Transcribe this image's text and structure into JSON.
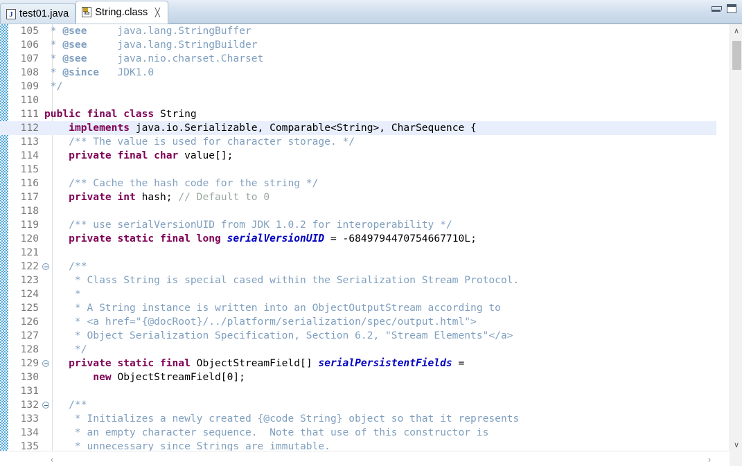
{
  "window": {
    "minimize_label": "–",
    "maximize_label": "□"
  },
  "tabs": [
    {
      "label": "test01.java",
      "icon": "java-file-icon",
      "active": false,
      "closable": false
    },
    {
      "label": "String.class",
      "icon": "class-file-icon",
      "active": true,
      "closable": true,
      "close_label": "╳"
    }
  ],
  "editor": {
    "first_line": 105,
    "current_line": 112,
    "fold_lines": [
      122,
      129,
      132
    ],
    "lines": [
      {
        "no": "105",
        "segments": [
          {
            "t": " * ",
            "c": "jdoc"
          },
          {
            "t": "@see",
            "c": "jtag"
          },
          {
            "t": "     java.lang.StringBuffer",
            "c": "jdoc"
          }
        ]
      },
      {
        "no": "106",
        "segments": [
          {
            "t": " * ",
            "c": "jdoc"
          },
          {
            "t": "@see",
            "c": "jtag"
          },
          {
            "t": "     java.lang.StringBuilder",
            "c": "jdoc"
          }
        ]
      },
      {
        "no": "107",
        "segments": [
          {
            "t": " * ",
            "c": "jdoc"
          },
          {
            "t": "@see",
            "c": "jtag"
          },
          {
            "t": "     java.nio.charset.Charset",
            "c": "jdoc"
          }
        ]
      },
      {
        "no": "108",
        "segments": [
          {
            "t": " * ",
            "c": "jdoc"
          },
          {
            "t": "@since",
            "c": "jtag"
          },
          {
            "t": "   JDK1.0",
            "c": "jdoc"
          }
        ]
      },
      {
        "no": "109",
        "segments": [
          {
            "t": " */",
            "c": "jdoc"
          }
        ]
      },
      {
        "no": "110",
        "segments": [
          {
            "t": "",
            "c": "plain"
          }
        ]
      },
      {
        "no": "111",
        "segments": [
          {
            "t": "public final class",
            "c": "kw"
          },
          {
            "t": " String",
            "c": "plain"
          }
        ]
      },
      {
        "no": "112",
        "segments": [
          {
            "t": "    ",
            "c": "plain"
          },
          {
            "t": "implements",
            "c": "kw"
          },
          {
            "t": " java.io.Serializable, Comparable<String>, CharSequence {",
            "c": "plain"
          }
        ]
      },
      {
        "no": "113",
        "segments": [
          {
            "t": "    /** The value is used for character storage. */",
            "c": "cmt"
          }
        ]
      },
      {
        "no": "114",
        "segments": [
          {
            "t": "    ",
            "c": "plain"
          },
          {
            "t": "private final char",
            "c": "kw"
          },
          {
            "t": " value[];",
            "c": "plain"
          }
        ]
      },
      {
        "no": "115",
        "segments": [
          {
            "t": "",
            "c": "plain"
          }
        ]
      },
      {
        "no": "116",
        "segments": [
          {
            "t": "    /** Cache the hash code for the string */",
            "c": "cmt"
          }
        ]
      },
      {
        "no": "117",
        "segments": [
          {
            "t": "    ",
            "c": "plain"
          },
          {
            "t": "private int",
            "c": "kw"
          },
          {
            "t": " hash; ",
            "c": "plain"
          },
          {
            "t": "// Default to 0",
            "c": "lcmt"
          }
        ]
      },
      {
        "no": "118",
        "segments": [
          {
            "t": "",
            "c": "plain"
          }
        ]
      },
      {
        "no": "119",
        "segments": [
          {
            "t": "    /** use serialVersionUID from JDK 1.0.2 for interoperability */",
            "c": "cmt"
          }
        ]
      },
      {
        "no": "120",
        "segments": [
          {
            "t": "    ",
            "c": "plain"
          },
          {
            "t": "private static final long",
            "c": "kw"
          },
          {
            "t": " ",
            "c": "plain"
          },
          {
            "t": "serialVersionUID",
            "c": "sfld"
          },
          {
            "t": " = -6849794470754667710L;",
            "c": "plain"
          }
        ]
      },
      {
        "no": "121",
        "segments": [
          {
            "t": "",
            "c": "plain"
          }
        ]
      },
      {
        "no": "122",
        "segments": [
          {
            "t": "    /**",
            "c": "jdoc"
          }
        ]
      },
      {
        "no": "123",
        "segments": [
          {
            "t": "     * Class String is special cased within the Serialization Stream Protocol.",
            "c": "jdoc"
          }
        ]
      },
      {
        "no": "124",
        "segments": [
          {
            "t": "     *",
            "c": "jdoc"
          }
        ]
      },
      {
        "no": "125",
        "segments": [
          {
            "t": "     * A String instance is written into an ObjectOutputStream according to",
            "c": "jdoc"
          }
        ]
      },
      {
        "no": "126",
        "segments": [
          {
            "t": "     * <a href=\"{@docRoot}/../platform/serialization/spec/output.html\">",
            "c": "jdoc"
          }
        ]
      },
      {
        "no": "127",
        "segments": [
          {
            "t": "     * Object Serialization Specification, Section 6.2, \"Stream Elements\"</a>",
            "c": "jdoc"
          }
        ]
      },
      {
        "no": "128",
        "segments": [
          {
            "t": "     */",
            "c": "jdoc"
          }
        ]
      },
      {
        "no": "129",
        "segments": [
          {
            "t": "    ",
            "c": "plain"
          },
          {
            "t": "private static final",
            "c": "kw"
          },
          {
            "t": " ObjectStreamField[] ",
            "c": "plain"
          },
          {
            "t": "serialPersistentFields",
            "c": "sfld"
          },
          {
            "t": " =",
            "c": "plain"
          }
        ]
      },
      {
        "no": "130",
        "segments": [
          {
            "t": "        ",
            "c": "plain"
          },
          {
            "t": "new",
            "c": "kw"
          },
          {
            "t": " ObjectStreamField[0];",
            "c": "plain"
          }
        ]
      },
      {
        "no": "131",
        "segments": [
          {
            "t": "",
            "c": "plain"
          }
        ]
      },
      {
        "no": "132",
        "segments": [
          {
            "t": "    /**",
            "c": "jdoc"
          }
        ]
      },
      {
        "no": "133",
        "segments": [
          {
            "t": "     * Initializes a newly created {@code String} object so that it represents",
            "c": "jdoc"
          }
        ]
      },
      {
        "no": "134",
        "segments": [
          {
            "t": "     * an empty character sequence.  Note that use of this constructor is",
            "c": "jdoc"
          }
        ]
      },
      {
        "no": "135",
        "segments": [
          {
            "t": "     * unnecessary since Strings are immutable.",
            "c": "jdoc"
          }
        ]
      }
    ]
  },
  "scrollbars": {
    "vertical_up_label": "∧",
    "vertical_down_label": "∨",
    "horizontal_left_label": "‹",
    "horizontal_right_label": "›"
  },
  "colors": {
    "keyword": "#7f0055",
    "javadoc": "#7f9fbf",
    "line_comment": "#9aa8a0",
    "static_field": "#0000c0",
    "current_line_highlight": "#e8eefb",
    "changebar": "#4da6dd",
    "tabbar": "#cfdded"
  }
}
